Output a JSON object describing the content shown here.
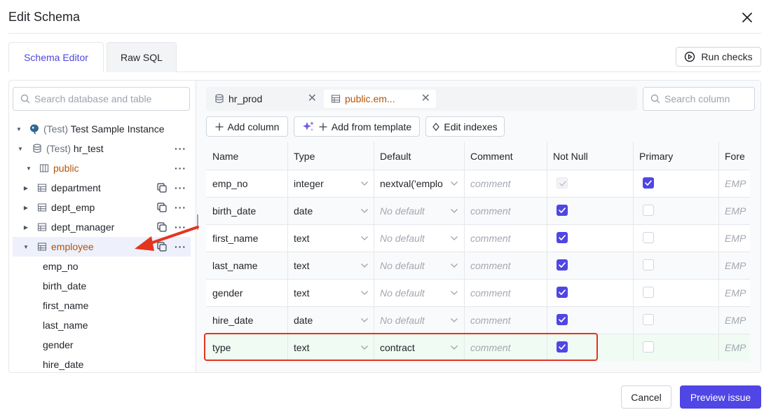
{
  "dialog": {
    "title": "Edit Schema"
  },
  "tabs": [
    {
      "label": "Schema Editor"
    },
    {
      "label": "Raw SQL"
    }
  ],
  "run_checks_label": "Run checks",
  "sidebar": {
    "search_placeholder": "Search database and table",
    "instance": {
      "prefix": "(Test)",
      "name": "Test Sample Instance"
    },
    "database": {
      "prefix": "(Test)",
      "name": "hr_test"
    },
    "schema": "public",
    "tables": [
      {
        "name": "department"
      },
      {
        "name": "dept_emp"
      },
      {
        "name": "dept_manager"
      },
      {
        "name": "employee"
      }
    ],
    "columns": [
      "emp_no",
      "birth_date",
      "first_name",
      "last_name",
      "gender",
      "hire_date"
    ]
  },
  "object_tabs": [
    {
      "label": "hr_prod"
    },
    {
      "label": "public.em..."
    }
  ],
  "column_search_placeholder": "Search column",
  "toolbar": {
    "add_column": "Add column",
    "add_from_template": "Add from template",
    "edit_indexes": "Edit indexes"
  },
  "grid": {
    "headers": [
      "Name",
      "Type",
      "Default",
      "Comment",
      "Not Null",
      "Primary",
      "Fore"
    ],
    "rows": [
      {
        "name": "emp_no",
        "type": "integer",
        "default": "nextval('emplo",
        "comment": "comment",
        "not_null": true,
        "not_null_disabled": true,
        "primary": true,
        "fk": "EMP"
      },
      {
        "name": "birth_date",
        "type": "date",
        "default": "No default",
        "comment": "comment",
        "not_null": true,
        "primary": false,
        "fk": "EMP"
      },
      {
        "name": "first_name",
        "type": "text",
        "default": "No default",
        "comment": "comment",
        "not_null": true,
        "primary": false,
        "fk": "EMP"
      },
      {
        "name": "last_name",
        "type": "text",
        "default": "No default",
        "comment": "comment",
        "not_null": true,
        "primary": false,
        "fk": "EMP"
      },
      {
        "name": "gender",
        "type": "text",
        "default": "No default",
        "comment": "comment",
        "not_null": true,
        "primary": false,
        "fk": "EMP"
      },
      {
        "name": "hire_date",
        "type": "date",
        "default": "No default",
        "comment": "comment",
        "not_null": true,
        "primary": false,
        "fk": "EMP"
      },
      {
        "name": "type",
        "type": "text",
        "default": "contract",
        "comment": "comment",
        "not_null": true,
        "primary": false,
        "fk": "EMP",
        "is_new": true
      }
    ]
  },
  "footer": {
    "cancel": "Cancel",
    "preview": "Preview issue"
  },
  "colors": {
    "accent": "#4f46e5",
    "highlight": "#e5341e",
    "arrow": "#e5341e",
    "amber": "#b45309",
    "new_row": "#f0fbf3"
  }
}
